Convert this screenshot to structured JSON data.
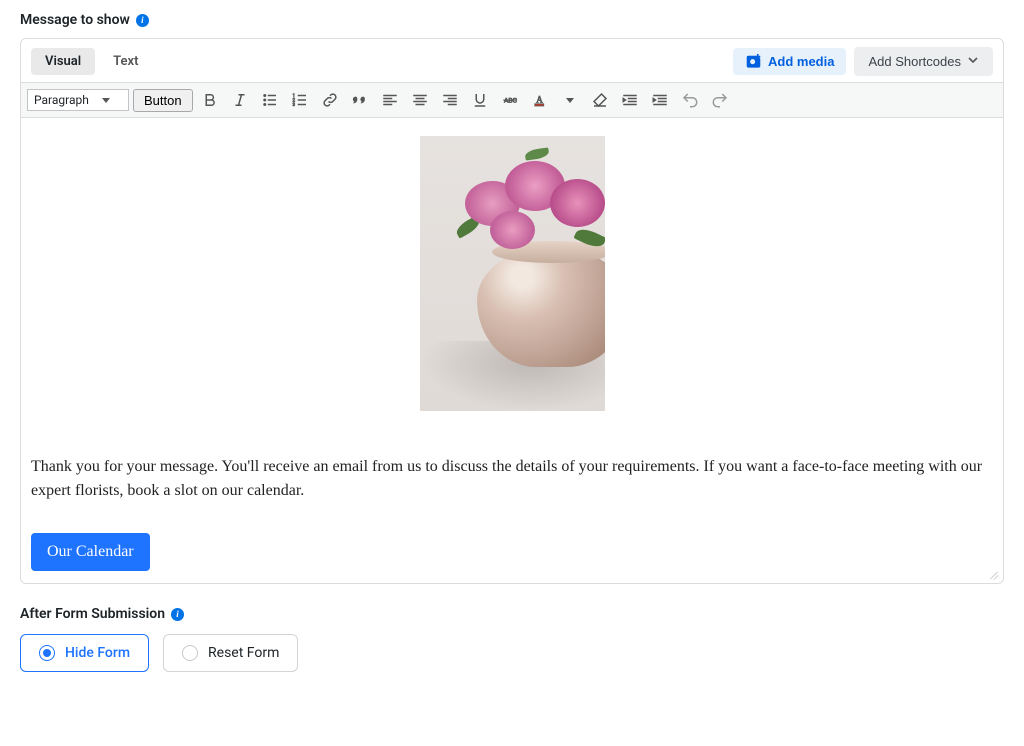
{
  "section1": {
    "title": "Message to show"
  },
  "editor": {
    "tabs": {
      "visual": "Visual",
      "text": "Text"
    },
    "buttons": {
      "add_media": "Add media",
      "add_shortcodes": "Add Shortcodes",
      "paragraph": "Paragraph",
      "button": "Button"
    },
    "content": {
      "paragraph": "Thank you for your message. You'll receive an email from us to discuss the details of your requirements. If you want a face-to-face meeting with our expert florists, book a slot on our calendar.",
      "cta_label": "Our Calendar"
    }
  },
  "section2": {
    "title": "After Form Submission"
  },
  "submission_options": {
    "hide": "Hide Form",
    "reset": "Reset Form",
    "selected": "hide"
  }
}
